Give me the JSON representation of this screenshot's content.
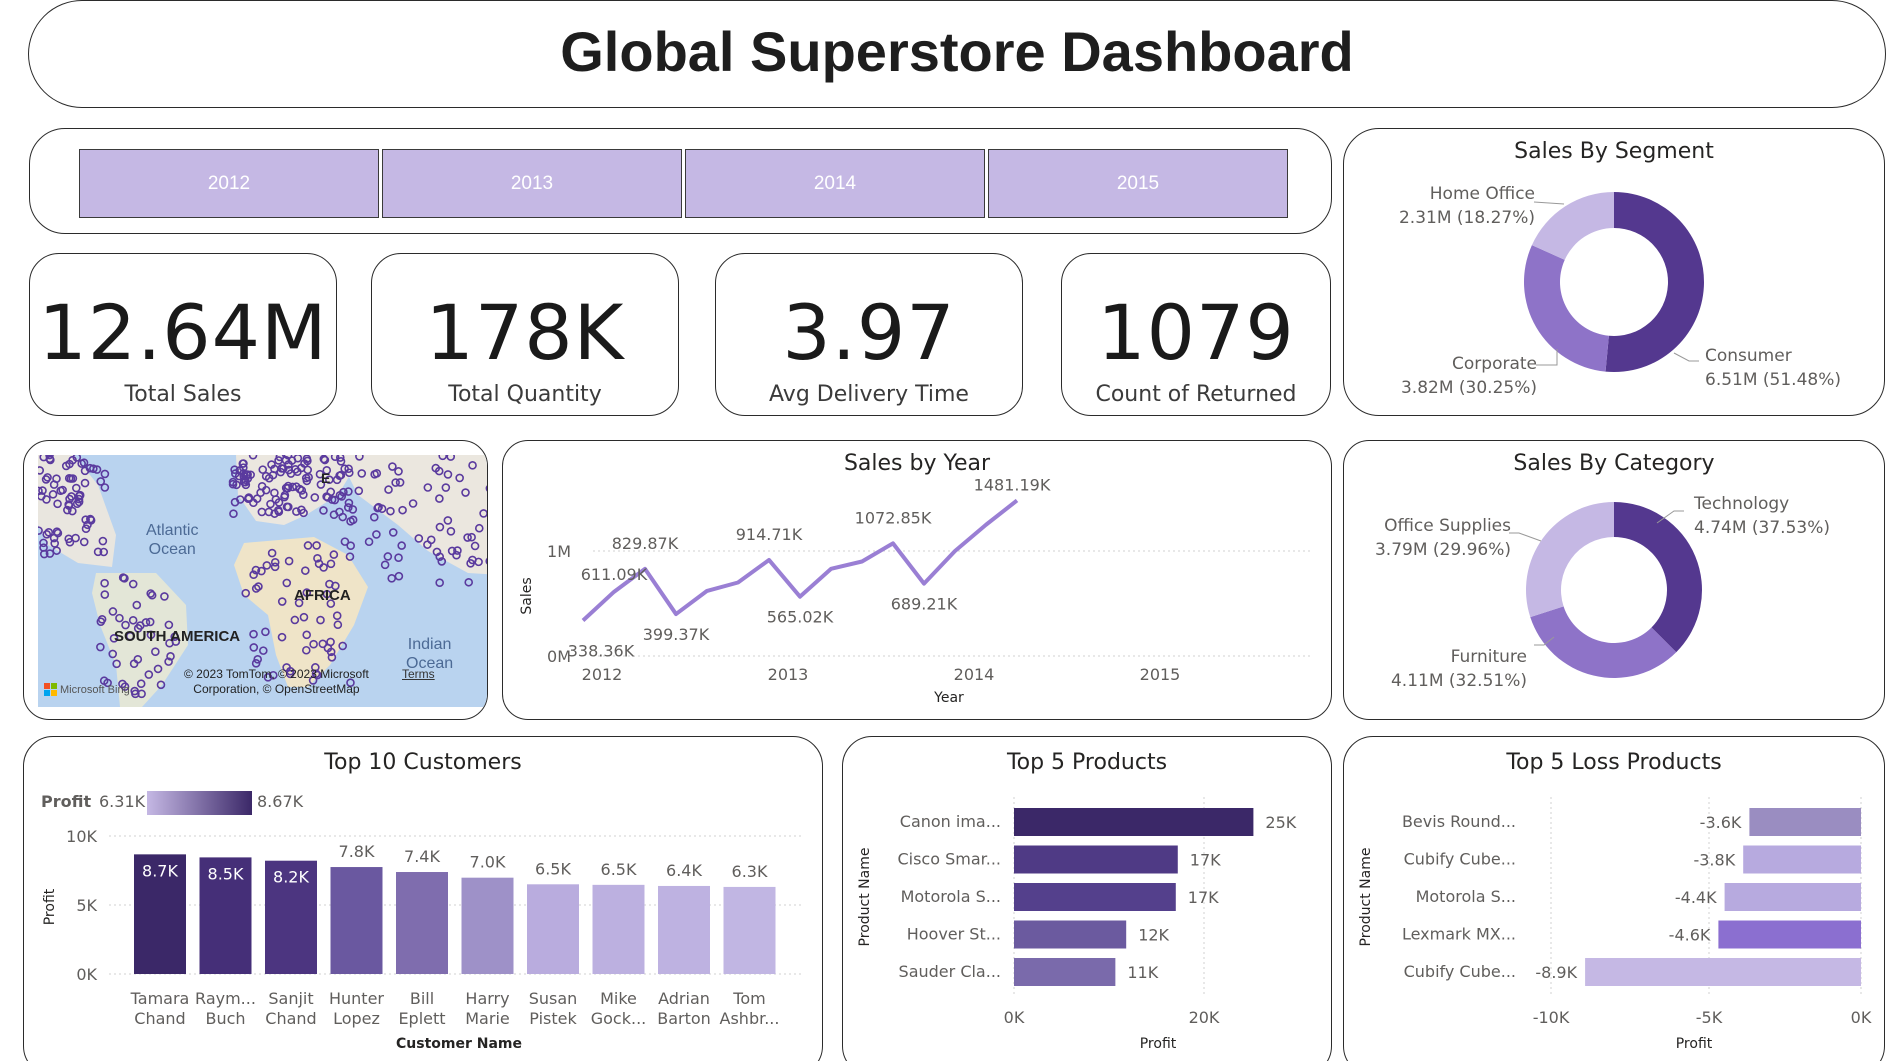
{
  "title": "Global Superstore Dashboard",
  "slicer": {
    "years": [
      "2012",
      "2013",
      "2014",
      "2015"
    ]
  },
  "kpis": [
    {
      "value": "12.64M",
      "label": "Total Sales"
    },
    {
      "value": "178K",
      "label": "Total Quantity"
    },
    {
      "value": "3.97",
      "label": "Avg Delivery Time"
    },
    {
      "value": "1079",
      "label": "Count of Returned"
    }
  ],
  "map": {
    "labels": {
      "atlantic": "Atlantic",
      "ocean": "Ocean",
      "africa": "AFRICA",
      "south_america": "SOUTH AMERICA",
      "indian": "Indian",
      "indian_ocean": "Ocean",
      "europe": "E",
      "asia": "A"
    },
    "copyright_line1": "© 2023 TomTom, © 2023 Microsoft",
    "copyright_line2": "Corporation, © OpenStreetMap",
    "terms": "Terms",
    "brand": "Microsoft Bing"
  },
  "colors": {
    "dark": "#3b2868",
    "purple": "#54388f",
    "mid": "#8e73c8",
    "light": "#c5b8e4",
    "line": "#9a7fd4",
    "map_point": "#5a3a9e"
  },
  "chart_data": [
    {
      "id": "sales-by-segment",
      "type": "pie",
      "title": "Sales By Segment",
      "slices": [
        {
          "label": "Consumer",
          "value": 6.51,
          "display": "6.51M (51.48%)",
          "percent": 51.48,
          "color": "#54388f"
        },
        {
          "label": "Corporate",
          "value": 3.82,
          "display": "3.82M (30.25%)",
          "percent": 30.25,
          "color": "#8e73c8"
        },
        {
          "label": "Home Office",
          "value": 2.31,
          "display": "2.31M (18.27%)",
          "percent": 18.27,
          "color": "#c5b8e4"
        }
      ]
    },
    {
      "id": "sales-by-category",
      "type": "pie",
      "title": "Sales By Category",
      "slices": [
        {
          "label": "Technology",
          "value": 4.74,
          "display": "4.74M (37.53%)",
          "percent": 37.53,
          "color": "#54388f"
        },
        {
          "label": "Furniture",
          "value": 4.11,
          "display": "4.11M (32.51%)",
          "percent": 32.51,
          "color": "#8e73c8"
        },
        {
          "label": "Office Supplies",
          "value": 3.79,
          "display": "3.79M (29.96%)",
          "percent": 29.96,
          "color": "#c5b8e4"
        }
      ]
    },
    {
      "id": "sales-by-year",
      "type": "line",
      "title": "Sales by Year",
      "xlabel": "Year",
      "ylabel": "Sales",
      "x_ticks": [
        "2012",
        "2013",
        "2014",
        "2015"
      ],
      "y_ticks": [
        "0M",
        "1M"
      ],
      "ylim": [
        0,
        1500000
      ],
      "points": [
        {
          "label": "338.36K",
          "value": 338360
        },
        {
          "label": "611.09K",
          "value": 611090
        },
        {
          "label": "829.87K",
          "value": 829870
        },
        {
          "label": "399.37K",
          "value": 399370
        },
        {
          "label": "",
          "value": 620000
        },
        {
          "label": "",
          "value": 700000
        },
        {
          "label": "914.71K",
          "value": 914710
        },
        {
          "label": "565.02K",
          "value": 565020
        },
        {
          "label": "",
          "value": 830000
        },
        {
          "label": "",
          "value": 900000
        },
        {
          "label": "1072.85K",
          "value": 1072850
        },
        {
          "label": "689.21K",
          "value": 689210
        },
        {
          "label": "",
          "value": 1000000
        },
        {
          "label": "",
          "value": 1250000
        },
        {
          "label": "1481.19K",
          "value": 1481190
        }
      ]
    },
    {
      "id": "top-10-customers",
      "type": "bar",
      "title": "Top 10 Customers",
      "xlabel": "Customer Name",
      "ylabel": "Profit",
      "legend": {
        "label": "Profit",
        "min": "6.31K",
        "max": "8.67K"
      },
      "y_ticks": [
        "0K",
        "5K",
        "10K"
      ],
      "ylim": [
        0,
        10000
      ],
      "categories": [
        [
          "Tamara",
          "Chand"
        ],
        [
          "Raym...",
          "Buch"
        ],
        [
          "Sanjit",
          "Chand"
        ],
        [
          "Hunter",
          "Lopez"
        ],
        [
          "Bill",
          "Eplett"
        ],
        [
          "Harry",
          "Marie"
        ],
        [
          "Susan",
          "Pistek"
        ],
        [
          "Mike",
          "Gock..."
        ],
        [
          "Adrian",
          "Barton"
        ],
        [
          "Tom",
          "Ashbr..."
        ]
      ],
      "values": [
        8670,
        8450,
        8210,
        7750,
        7390,
        6980,
        6500,
        6460,
        6380,
        6310
      ],
      "labels": [
        "8.7K",
        "8.5K",
        "8.2K",
        "7.8K",
        "7.4K",
        "7.0K",
        "6.5K",
        "6.5K",
        "6.4K",
        "6.3K"
      ],
      "colors": [
        "#3b2868",
        "#452f78",
        "#4c3580",
        "#6a58a0",
        "#7f6dae",
        "#9e91c8",
        "#b9acde",
        "#bcb0e0",
        "#beb2e1",
        "#c1b6e3"
      ]
    },
    {
      "id": "top-5-products",
      "type": "bar",
      "orientation": "horizontal",
      "title": "Top 5 Products",
      "xlabel": "Profit",
      "ylabel": "Product Name",
      "x_ticks": [
        "0K",
        "20K"
      ],
      "xlim": [
        0,
        25000
      ],
      "categories": [
        "Canon ima...",
        "Cisco Smar...",
        "Motorola S...",
        "Hoover St...",
        "Sauder Cla..."
      ],
      "values": [
        25200,
        17240,
        17030,
        11810,
        10670
      ],
      "labels": [
        "25K",
        "17K",
        "17K",
        "12K",
        "11K"
      ],
      "colors": [
        "#3b2868",
        "#4f3a85",
        "#54408c",
        "#6b5a9f",
        "#7a6aab"
      ]
    },
    {
      "id": "top-5-loss-products",
      "type": "bar",
      "orientation": "horizontal",
      "title": "Top 5 Loss Products",
      "xlabel": "Profit",
      "ylabel": "Product Name",
      "x_ticks": [
        "-10K",
        "-5K",
        "0K"
      ],
      "xlim": [
        -10000,
        0
      ],
      "categories": [
        "Bevis Round...",
        "Cubify Cube...",
        "Motorola S...",
        "Lexmark MX...",
        "Cubify Cube..."
      ],
      "values": [
        -3600,
        -3800,
        -4400,
        -4600,
        -8900
      ],
      "labels": [
        "-3.6K",
        "-3.8K",
        "-4.4K",
        "-4.6K",
        "-8.9K"
      ],
      "colors": [
        "#9a8dc1",
        "#b7aadf",
        "#b7aadf",
        "#8b6fd0",
        "#c5b8e4"
      ]
    }
  ]
}
